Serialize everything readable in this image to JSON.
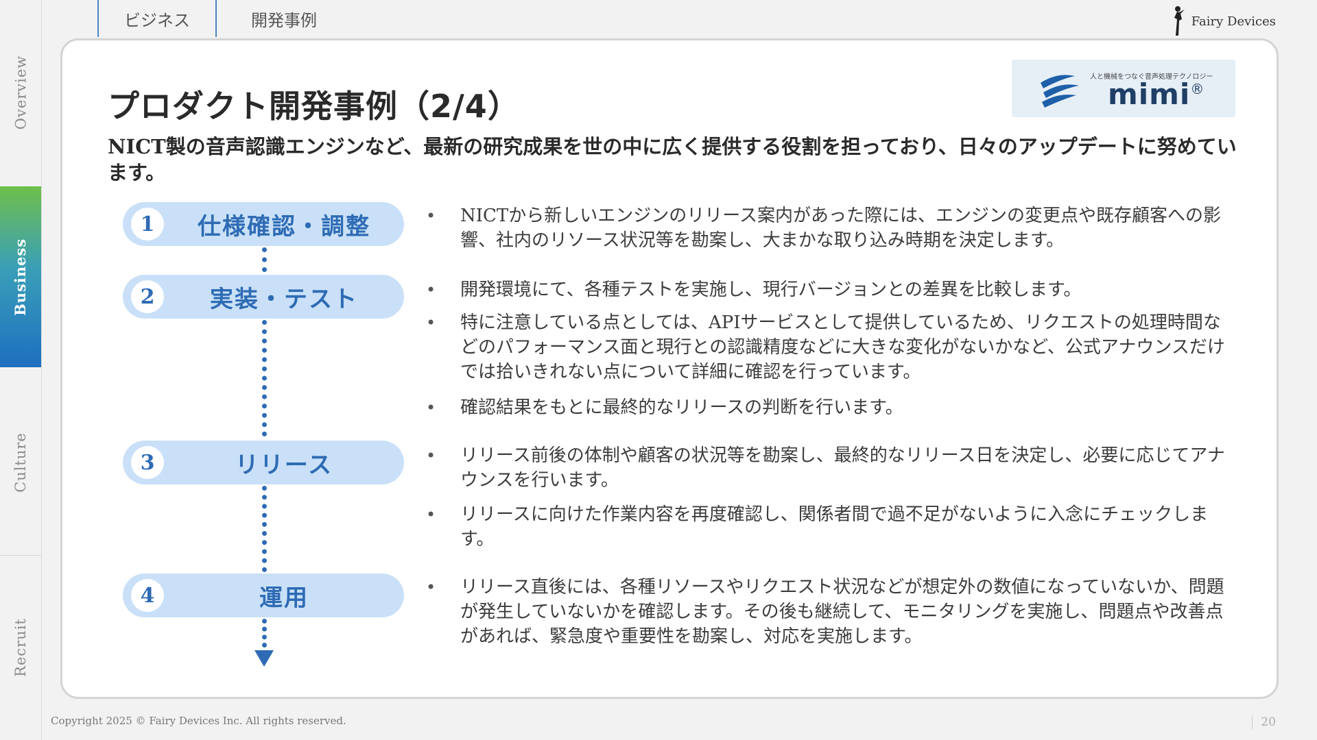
{
  "nav": {
    "items": [
      {
        "label": "Overview",
        "active": false
      },
      {
        "label": "Business",
        "active": true
      },
      {
        "label": "Culture",
        "active": false
      },
      {
        "label": "Recruit",
        "active": false
      }
    ]
  },
  "tabs": [
    "ビジネス",
    "開発事例"
  ],
  "brand": {
    "name": "Fairy Devices",
    "icon": "fairy-icon"
  },
  "logo": {
    "tagline": "人と機械をつなぐ音声処理テクノロジー",
    "word": "mimi",
    "reg": "®",
    "colors": {
      "mark": "#1e5fa8",
      "word": "#1f3f66"
    }
  },
  "title": "プロダクト開発事例（2/4）",
  "lead": "NICT製の音声認識エンジンなど、最新の研究成果を世の中に広く提供する役割を担っており、日々のアップデートに努めています。",
  "steps": [
    {
      "num": "1",
      "label": "仕様確認・調整"
    },
    {
      "num": "2",
      "label": "実装・テスト"
    },
    {
      "num": "3",
      "label": "リリース"
    },
    {
      "num": "4",
      "label": "運用"
    }
  ],
  "bullets": [
    "NICTから新しいエンジンのリリース案内があった際には、エンジンの変更点や既存顧客への影響、社内のリソース状況等を勘案し、大まかな取り込み時期を決定します。",
    "開発環境にて、各種テストを実施し、現行バージョンとの差異を比較します。",
    "特に注意している点としては、APIサービスとして提供しているため、リクエストの処理時間などのパフォーマンス面と現行との認識精度などに大きな変化がないかなど、公式アナウンスだけでは拾いきれない点について詳細に確認を行っています。",
    "確認結果をもとに最終的なリリースの判断を行います。",
    "リリース前後の体制や顧客の状況等を勘案し、最終的なリリース日を決定し、必要に応じてアナウンスを行います。",
    "リリースに向けた作業内容を再度確認し、関係者間で過不足がないように入念にチェックします。",
    "リリース直後には、各種リソースやリクエスト状況などが想定外の数値になっていないか、問題が発生していないかを確認します。その後も継続して、モニタリングを実施し、問題点や改善点があれば、緊急度や重要性を勘案し、対応を実施します。"
  ],
  "footer": "Copyright  2025 © Fairy Devices Inc. All rights reserved.",
  "page_number": "20",
  "colors": {
    "accent": "#2e6bb4",
    "pill": "#c9e0f8",
    "nav_active_top": "#6fbf4a",
    "nav_active_bottom": "#1e6fc0"
  }
}
